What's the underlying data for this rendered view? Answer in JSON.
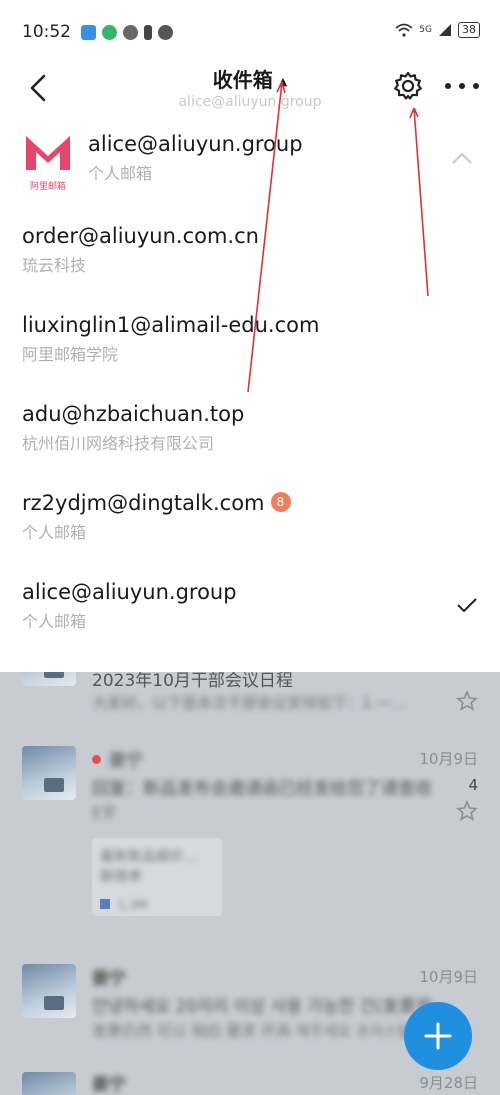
{
  "status_bar": {
    "time": "10:52",
    "signal": "5G",
    "battery": "38"
  },
  "header": {
    "title": "收件箱",
    "caret": "▲",
    "subtitle": "alice@aliuyun.group"
  },
  "accounts": [
    {
      "email": "alice@aliuyun.group",
      "name": "个人邮箱"
    },
    {
      "email": "order@aliuyun.com.cn",
      "name": "琉云科技"
    },
    {
      "email": "liuxinglin1@alimail-edu.com",
      "name": "阿里邮箱学院"
    },
    {
      "email": "adu@hzbaichuan.top",
      "name": "杭州佰川网络科技有限公司"
    },
    {
      "email": "rz2ydjm@dingtalk.com",
      "name": "个人邮箱",
      "badge": "8"
    },
    {
      "email": "alice@aliuyun.group",
      "name": "个人邮箱"
    }
  ],
  "logo": {
    "text": "阿里邮箱"
  },
  "mail_list": [
    {
      "subject": "2023年10月干部会议日程",
      "preview": "大家好，以下是本次干部会议安排如下：1.一..."
    },
    {
      "sender": "姜宁",
      "date": "10月9日",
      "subject": "回复：新品发布会邀请函已经发给您了请查收",
      "preview": "E字",
      "count": "4",
      "attachment_title": "最新新品报价...",
      "attachment_line": "联络单",
      "attachment_size": "1.3M"
    },
    {
      "sender": "姜宁",
      "date": "10月9日",
      "subject": "안녕하세요 20자리 이상 사용 가능한 건(发票号...",
      "preview": "发票仍然 可以 稍后 要求 开具 해주세요 초이스발"
    },
    {
      "sender": "姜宁",
      "date": "9月28日"
    }
  ],
  "colors": {
    "accent": "#1f8fe0",
    "badge": "#f07d5c",
    "unread_dot": "#e94c4c",
    "annotation": "#e0303a"
  }
}
